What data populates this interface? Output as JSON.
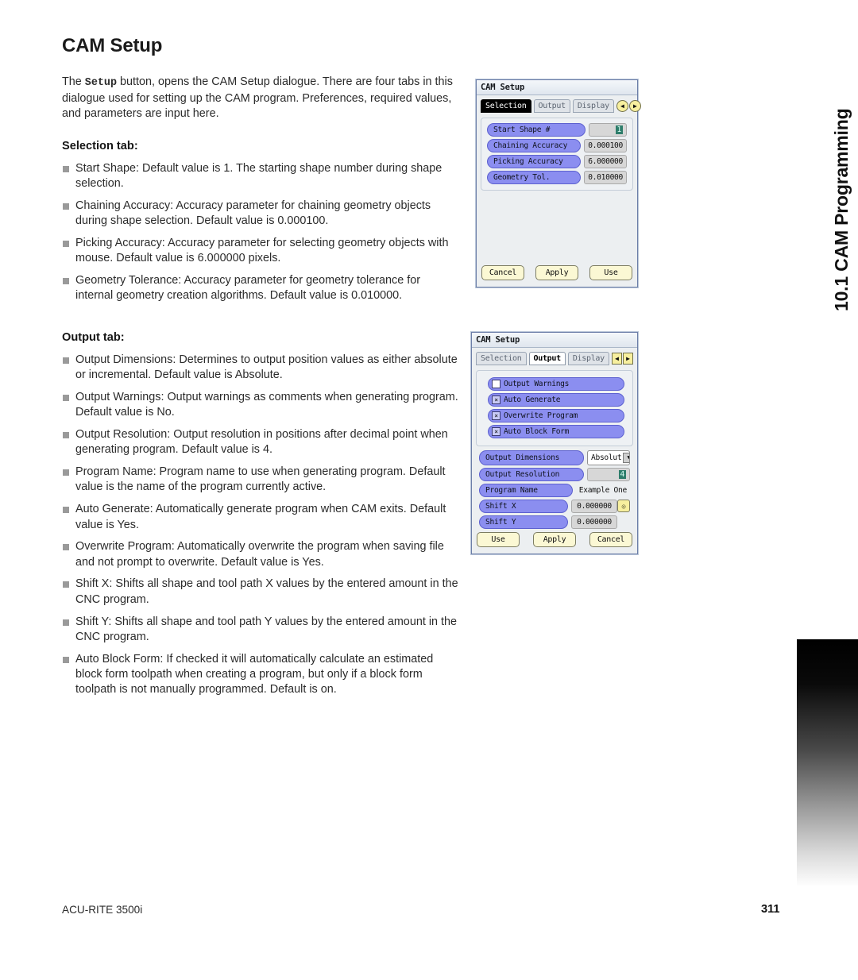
{
  "page": {
    "title": "CAM Setup",
    "intro_before": "The ",
    "intro_bold": "Setup",
    "intro_after": " button, opens the CAM Setup dialogue.  There are four tabs in this dialogue used for setting up the CAM program.  Preferences, required values, and parameters are input here.",
    "selection_head": "Selection tab:",
    "output_head": "Output tab:"
  },
  "selection_bullets": [
    "Start Shape:  Default value is 1.  The starting shape number during shape selection.",
    "Chaining Accuracy:  Accuracy parameter for chaining geometry objects during shape selection. Default value is 0.000100.",
    "Picking Accuracy:  Accuracy parameter for selecting geometry objects with mouse. Default value is 6.000000 pixels.",
    "Geometry Tolerance:  Accuracy parameter for geometry tolerance for internal geometry creation algorithms. Default value is 0.010000."
  ],
  "output_bullets": [
    "Output Dimensions:  Determines to output position values as either absolute or incremental. Default value is Absolute.",
    "Output Warnings:  Output warnings as comments when generating program. Default value is No.",
    "Output Resolution:  Output resolution in positions after decimal point when generating program. Default value is 4.",
    "Program Name:  Program name to use when generating program. Default value is the name of the program currently active.",
    "Auto Generate: Automatically generate program when CAM exits. Default value is Yes.",
    "Overwrite Program:  Automatically overwrite the program when saving file and not prompt to overwrite. Default value is Yes.",
    "Shift X:  Shifts all shape and tool path X values by the entered amount in the CNC program.",
    "Shift Y:  Shifts all shape and tool path Y values by the entered amount in the CNC program.",
    "Auto Block Form: If checked it will automatically calculate an estimated block form toolpath when creating a program, but  only if a block form toolpath is not manually programmed. Default is on."
  ],
  "chapter_tab": {
    "label": "10.1 CAM Programming"
  },
  "footer": {
    "left": "ACU-RITE 3500i",
    "page_number": "311"
  },
  "dialog_selection": {
    "title": "CAM Setup",
    "tabs": [
      {
        "label": "Selection",
        "state": "selected"
      },
      {
        "label": "Output",
        "state": "normal"
      },
      {
        "label": "Display",
        "state": "normal"
      }
    ],
    "nav_prev": "◀",
    "nav_next": "▶",
    "fields": [
      {
        "label": "Start Shape #",
        "value": "1",
        "highlight": true
      },
      {
        "label": "Chaining Accuracy",
        "value": "0.000100",
        "highlight": false
      },
      {
        "label": "Picking Accuracy",
        "value": "6.000000",
        "highlight": false
      },
      {
        "label": "Geometry Tol.",
        "value": "0.010000",
        "highlight": false
      }
    ],
    "buttons": [
      "Cancel",
      "Apply",
      "Use"
    ]
  },
  "dialog_output": {
    "title": "CAM Setup",
    "tabs": [
      {
        "label": "Selection",
        "state": "normal"
      },
      {
        "label": "Output",
        "state": "selected"
      },
      {
        "label": "Display",
        "state": "normal"
      }
    ],
    "nav_prev": "◀",
    "nav_next": "▶",
    "checkboxes": [
      {
        "label": "Output Warnings",
        "checked": false,
        "mark": ""
      },
      {
        "label": "Auto Generate",
        "checked": true,
        "mark": "×"
      },
      {
        "label": "Overwrite Program",
        "checked": true,
        "mark": "×"
      },
      {
        "label": "Auto Block Form",
        "checked": true,
        "mark": "×"
      }
    ],
    "fields": [
      {
        "label": "Output Dimensions",
        "value": "Absolut",
        "kind": "combo",
        "caret": "▼"
      },
      {
        "label": "Output Resolution",
        "value": "4",
        "kind": "value-highlight"
      },
      {
        "label": "Program Name",
        "value": "Example One",
        "kind": "plain"
      },
      {
        "label": "Shift X",
        "value": "0.000000",
        "kind": "plain"
      },
      {
        "label": "Shift Y",
        "value": "0.000000",
        "kind": "plain"
      }
    ],
    "spin_icon": "◎",
    "buttons": [
      "Use",
      "Apply",
      "Cancel"
    ]
  },
  "colors": {
    "field_label": "#8b8ef0",
    "button": "#fbf8d4",
    "selected_tab": "#000000"
  }
}
